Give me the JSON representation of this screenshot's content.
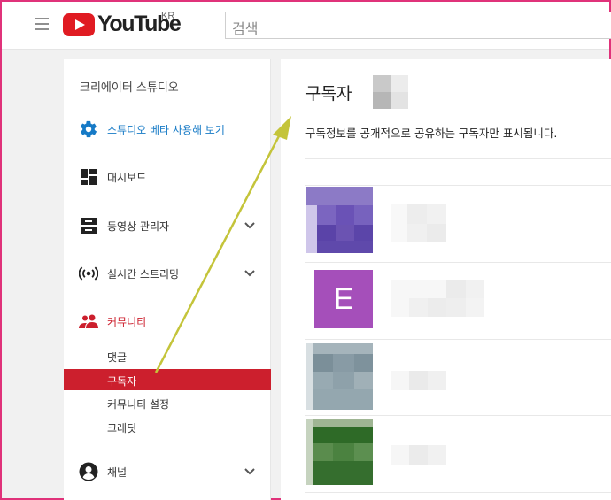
{
  "header": {
    "logo_text": "YouTube",
    "region": "KR",
    "search_placeholder": "검색"
  },
  "sidebar": {
    "studio_title": "크리에이터 스튜디오",
    "beta_link": "스튜디오 베타 사용해 보기",
    "items": [
      {
        "label": "대시보드",
        "icon": "dashboard-icon"
      },
      {
        "label": "동영상 관리자",
        "icon": "video-manager-icon"
      },
      {
        "label": "실시간 스트리밍",
        "icon": "live-streaming-icon"
      },
      {
        "label": "커뮤니티",
        "icon": "community-icon"
      },
      {
        "label": "채널",
        "icon": "channel-icon"
      }
    ],
    "community_sub": [
      {
        "label": "댓글"
      },
      {
        "label": "구독자"
      },
      {
        "label": "커뮤니티 설정"
      },
      {
        "label": "크레딧"
      }
    ]
  },
  "main": {
    "title": "구독자",
    "description": "구독정보를 공개적으로 공유하는 구독자만 표시됩니다.",
    "subscribers": [
      {
        "avatar_color": "#6a4fb6"
      },
      {
        "avatar_letter": "E",
        "avatar_color": "#a54fba"
      },
      {
        "avatar_color": "#8a9ea8"
      },
      {
        "avatar_color": "#3c7a36"
      }
    ]
  },
  "colors": {
    "accent_red": "#cc1f2d",
    "link_blue": "#167ac6",
    "arrow": "#c4c43a"
  }
}
